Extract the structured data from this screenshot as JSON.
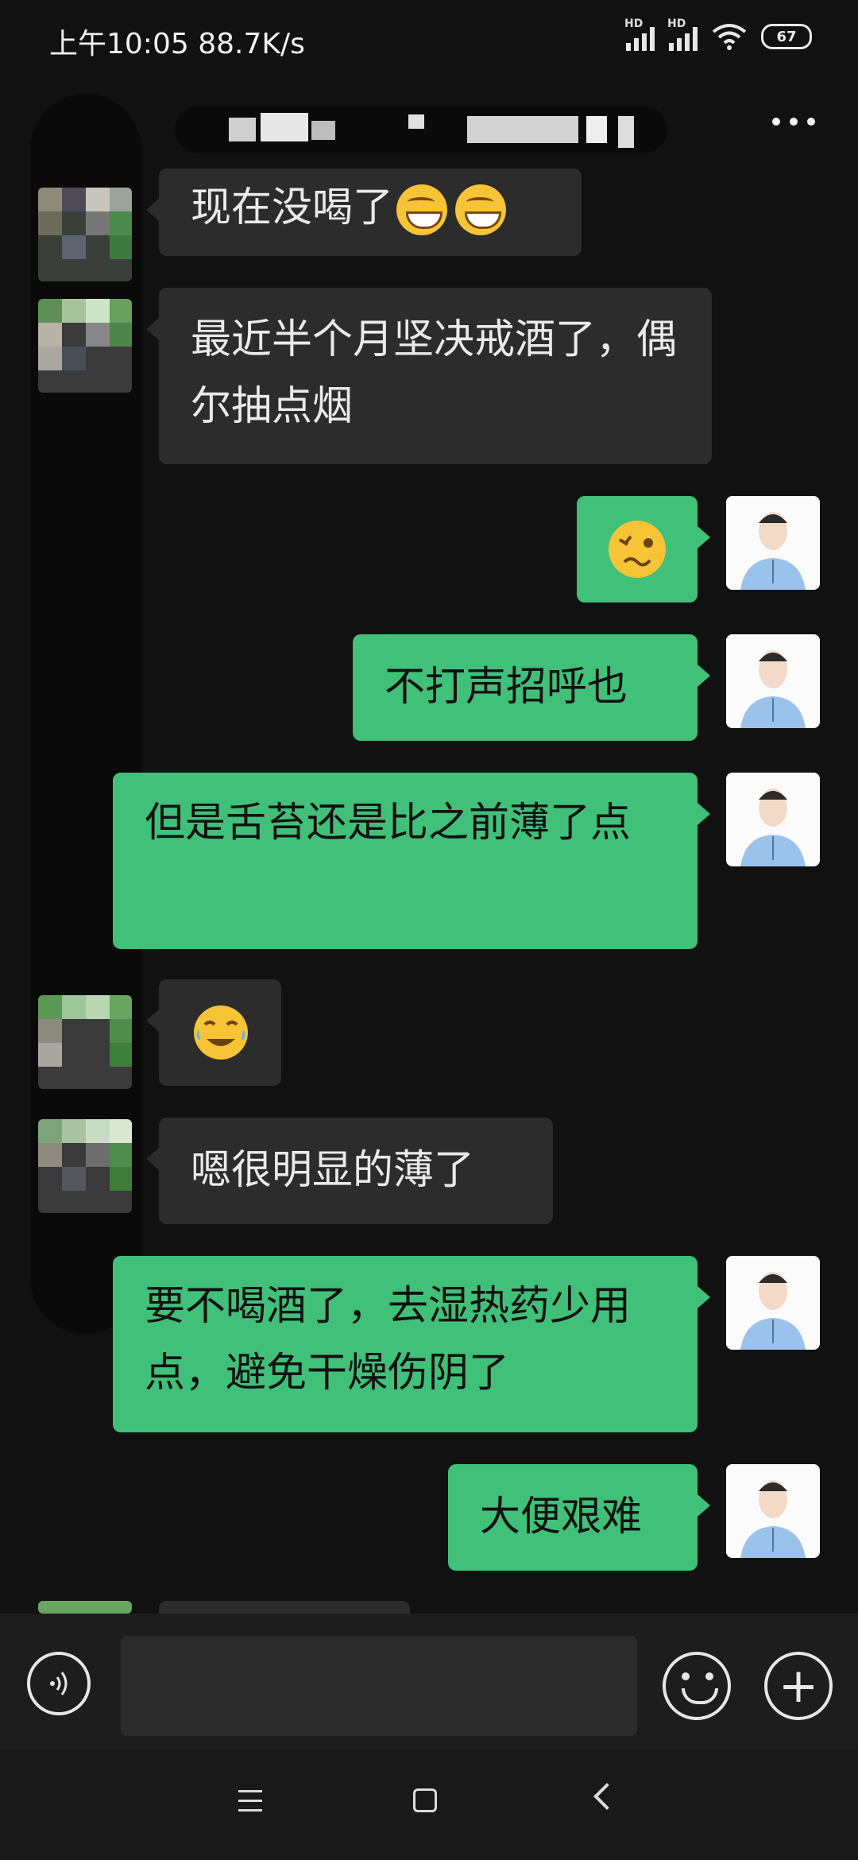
{
  "status_bar": {
    "time_speed": "上午10:05 88.7K/s",
    "network_badge_1": "HD",
    "network_badge_2": "HD",
    "battery": "67"
  },
  "header": {
    "more_icon": "more-dots-icon"
  },
  "messages": [
    {
      "side": "in",
      "text": "现在没喝了"
    },
    {
      "side": "in",
      "text": "最近半个月坚决戒酒了，偶尔抽点烟"
    },
    {
      "side": "out",
      "text": ""
    },
    {
      "side": "out",
      "text": "不打声招呼也"
    },
    {
      "side": "out",
      "text": "但是舌苔还是比之前薄了点"
    },
    {
      "side": "in",
      "text": ""
    },
    {
      "side": "in",
      "text": "嗯很明显的薄了"
    },
    {
      "side": "out",
      "text": "要不喝酒了，去湿热药少用点，避免干燥伤阴了"
    },
    {
      "side": "out",
      "text": "大便艰难"
    }
  ],
  "composer": {
    "voice_icon": "voice-icon",
    "emoji_icon": "emoji-icon",
    "plus_icon": "plus-icon"
  },
  "nav": {
    "menu": "menu-icon",
    "home": "home-icon",
    "back": "back-icon"
  }
}
